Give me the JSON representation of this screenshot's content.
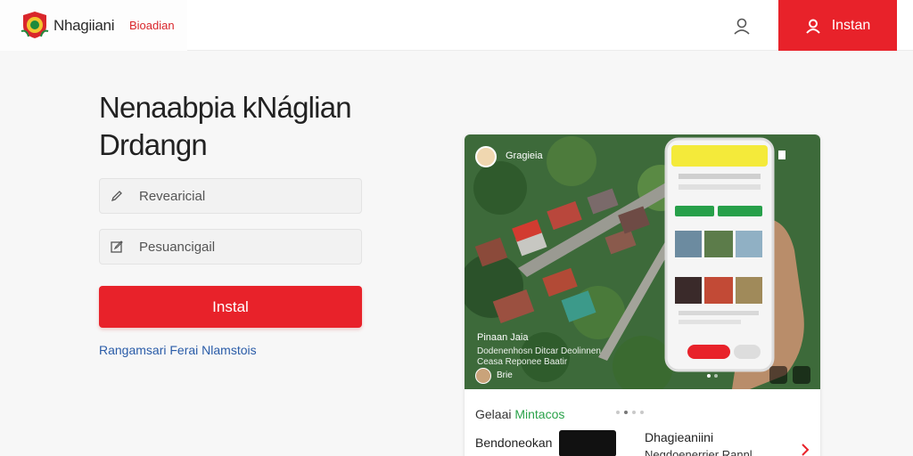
{
  "header": {
    "brand": "Nhagiiani",
    "brand_sub": "Bioadian",
    "install_label": "Instan"
  },
  "form": {
    "title": "Nenaabpia kNáglian Drdangn",
    "field1_placeholder": "Revearicial",
    "field2_placeholder": "Pesuancigail",
    "submit_label": "Instal",
    "link_label": "Rangamsari Ferai Nlamstois"
  },
  "preview": {
    "post_author": "Gragieia",
    "caption": "Pinaan Jaia",
    "caption_line2": "Dodenenhosn Ditcar Deolinnen",
    "caption_line3": "Ceasa Reponee Baatir",
    "meta": "Brie",
    "section_title_a": "Gelaai",
    "section_title_b": "Mintacos",
    "item_text": "Bendoneokan",
    "item_title": "Dhagieaniini",
    "item_sub": "Negdoenerrier Rannl"
  },
  "colors": {
    "accent": "#e8222a",
    "link": "#2a5ca8",
    "green": "#2aa24a"
  }
}
